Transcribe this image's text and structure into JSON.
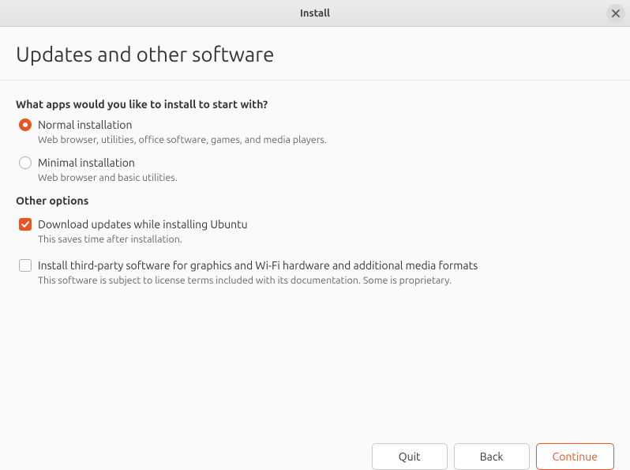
{
  "titlebar": {
    "title": "Install"
  },
  "page": {
    "heading": "Updates and other software"
  },
  "install_type": {
    "question": "What apps would you like to install to start with?",
    "options": [
      {
        "label": "Normal installation",
        "description": "Web browser, utilities, office software, games, and media players.",
        "selected": true
      },
      {
        "label": "Minimal installation",
        "description": "Web browser and basic utilities.",
        "selected": false
      }
    ]
  },
  "other_options": {
    "heading": "Other options",
    "items": [
      {
        "label": "Download updates while installing Ubuntu",
        "description": "This saves time after installation.",
        "checked": true
      },
      {
        "label": "Install third-party software for graphics and Wi-Fi hardware and additional media formats",
        "description": "This software is subject to license terms included with its documentation. Some is proprietary.",
        "checked": false
      }
    ]
  },
  "buttons": {
    "quit": "Quit",
    "back": "Back",
    "continue": "Continue"
  }
}
